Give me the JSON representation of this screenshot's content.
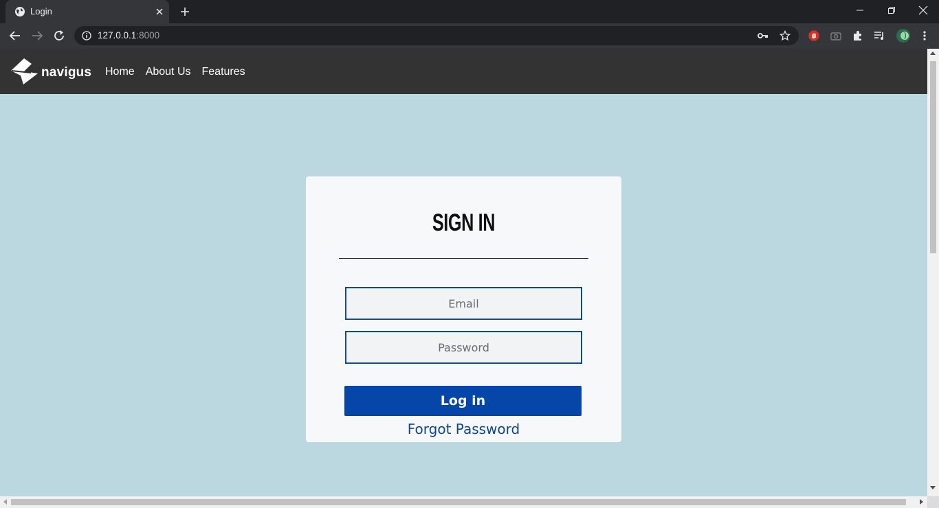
{
  "browser": {
    "tab_title": "Login",
    "url_host": "127.0.0.1",
    "url_port": ":8000"
  },
  "site": {
    "brand": "navigus",
    "nav": [
      "Home",
      "About Us",
      "Features"
    ]
  },
  "login": {
    "title": "SIGN IN",
    "email_placeholder": "Email",
    "password_placeholder": "Password",
    "submit_label": "Log in",
    "forgot_label": "Forgot Password"
  },
  "colors": {
    "page_background": "#bbd8e0",
    "nav_background": "#333333",
    "button_primary": "#0646a8",
    "link": "#10468e"
  },
  "icons": [
    "globe-icon",
    "close-icon",
    "plus-icon",
    "minimize-icon",
    "restore-icon",
    "back-icon",
    "forward-icon",
    "reload-icon",
    "info-icon",
    "key-icon",
    "star-icon",
    "adblock-icon",
    "camera-icon",
    "extensions-icon",
    "media-icon",
    "profile-avatar",
    "menu-icon"
  ]
}
